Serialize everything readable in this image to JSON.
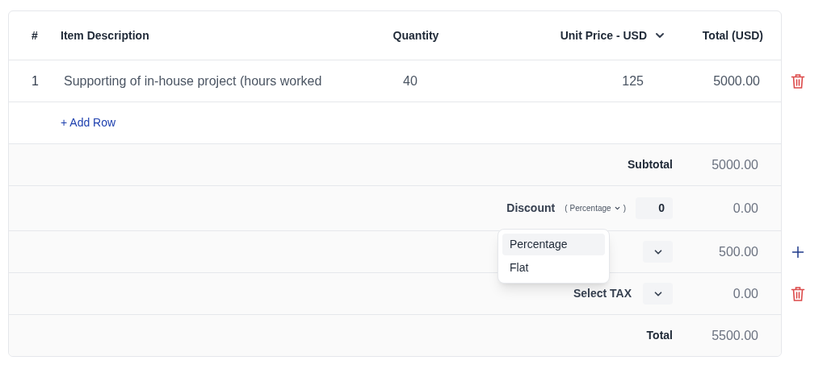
{
  "table": {
    "columns": [
      {
        "label": "#",
        "has_menu": false
      },
      {
        "label": "Item Description",
        "has_menu": false
      },
      {
        "label": "Quantity",
        "has_menu": false
      },
      {
        "label": "Unit Price - USD",
        "has_menu": true
      },
      {
        "label": "Total  (USD)",
        "has_menu": false
      }
    ],
    "rows": [
      {
        "number": "1",
        "description": "Supporting of in-house project (hours worked",
        "quantity": "40",
        "unit_price": "125",
        "total": "5000.00",
        "deletable": true
      }
    ],
    "add_row": "+ Add Row"
  },
  "summary": [
    {
      "kind": "subtotal",
      "label": "Subtotal",
      "value": "5000.00"
    },
    {
      "kind": "discount",
      "label": "Discount",
      "mode_open": "(",
      "mode": "Percentage",
      "mode_close": ")",
      "input": "0",
      "value": "0.00"
    },
    {
      "kind": "tax",
      "value": "500.00",
      "addable": true
    },
    {
      "kind": "tax",
      "label": "Select TAX",
      "value": "0.00",
      "deletable": true
    },
    {
      "kind": "total",
      "label": "Total",
      "value": "5500.00"
    }
  ],
  "discount_menu": {
    "items": [
      {
        "label": "Percentage",
        "selected": true
      },
      {
        "label": "Flat",
        "selected": false
      }
    ]
  }
}
